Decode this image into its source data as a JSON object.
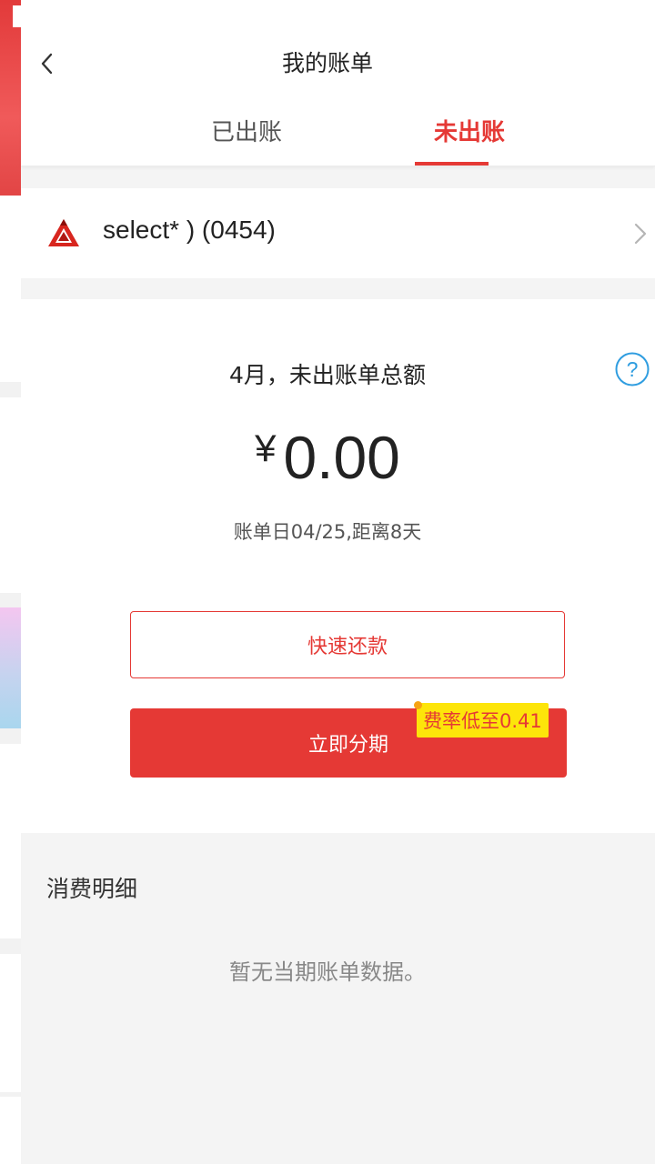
{
  "header": {
    "title": "我的账单"
  },
  "tabs": [
    {
      "label": "已出账",
      "active": false
    },
    {
      "label": "未出账",
      "active": true
    }
  ],
  "card": {
    "name": "select* ) (0454)"
  },
  "summary": {
    "title": "4月，未出账单总额",
    "currency": "¥",
    "amount": "0.00",
    "due_info": "账单日04/25,距离8天"
  },
  "actions": {
    "repay_label": "快速还款",
    "installment_label": "立即分期",
    "rate_badge": "费率低至0.41"
  },
  "details": {
    "title": "消费明细",
    "empty_message": "暂无当期账单数据。"
  },
  "colors": {
    "accent": "#e53935",
    "badge": "#fde50a",
    "help": "#2f9de0"
  },
  "icons": {
    "back": "chevron-left-icon",
    "help": "question-circle-icon",
    "card_more": "chevron-right-icon",
    "bank": "bank-logo-icon"
  }
}
